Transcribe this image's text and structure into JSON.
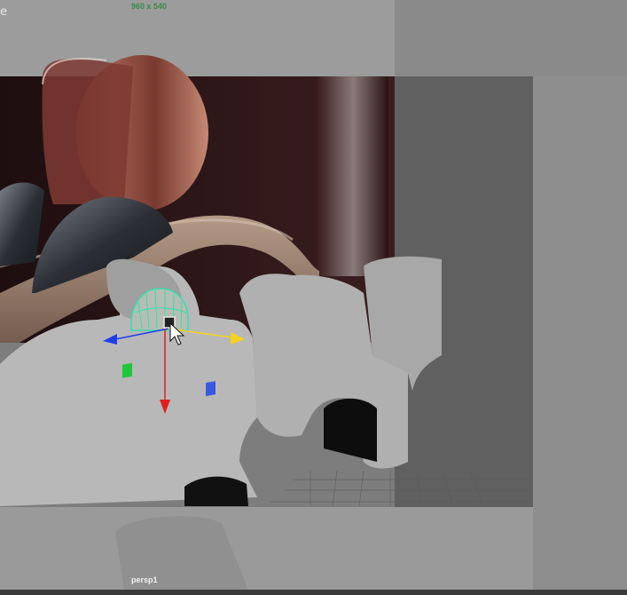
{
  "viewport": {
    "resolution_gate_label": "960 x 540",
    "camera_name": "persp1",
    "edge_glyph": "e"
  },
  "gizmo": {
    "x_axis_color": "#e02020",
    "y_axis_color": "#f2d21e",
    "z_axis_color": "#1f3ee8",
    "selection_highlight_color": "#34e0b0"
  },
  "scene": {
    "background_color": "#8f8f8f",
    "render_region_color": "#2a1416",
    "gate_overlay_color": "#9a9a9a"
  }
}
